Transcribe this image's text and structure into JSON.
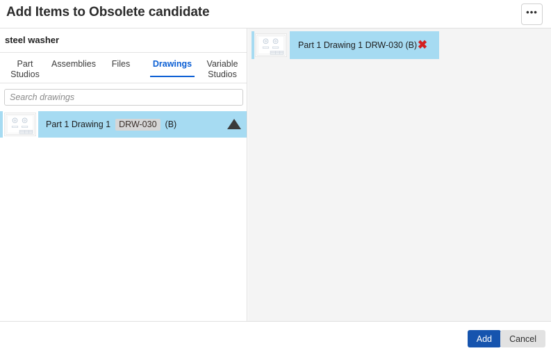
{
  "dialog": {
    "title": "Add Items to Obsolete candidate",
    "overflow_menu_icon": "ellipsis-icon",
    "overflow_menu_label": "•••"
  },
  "left_pane": {
    "document_name": "steel washer",
    "tabs": [
      {
        "label": "Part Studios",
        "active": false
      },
      {
        "label": "Assemblies",
        "active": false
      },
      {
        "label": "Files",
        "active": false
      },
      {
        "label": "Drawings",
        "active": true
      },
      {
        "label": "Variable Studios",
        "active": false
      }
    ],
    "search": {
      "placeholder": "Search drawings",
      "value": ""
    },
    "results": [
      {
        "thumbnail_icon": "drawing-thumbnail-icon",
        "name": "Part 1 Drawing 1",
        "part_number": "DRW-030",
        "revision": "(B)",
        "expand_icon": "triangle-up-icon",
        "selected": true
      }
    ]
  },
  "right_pane": {
    "selected_items": [
      {
        "thumbnail_icon": "drawing-thumbnail-icon",
        "label": "Part 1 Drawing 1 DRW-030 (B)",
        "remove_icon": "close-x-icon",
        "remove_glyph": "✖"
      }
    ]
  },
  "footer": {
    "add_label": "Add",
    "cancel_label": "Cancel"
  },
  "colors": {
    "accent_blue": "#0b5fd4",
    "primary_button": "#1654ae",
    "selection_blue": "#a6dbf2",
    "remove_red": "#d32020",
    "panel_gray": "#f4f4f4"
  }
}
